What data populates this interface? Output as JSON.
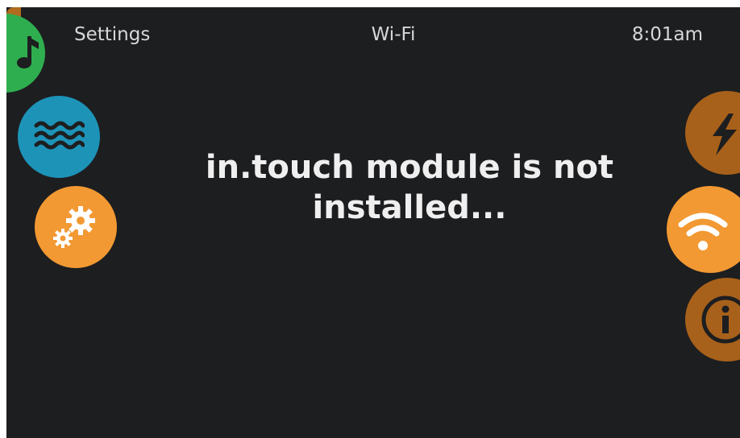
{
  "header": {
    "left_label": "Settings",
    "title": "Wi-Fi",
    "time": "8:01am"
  },
  "message": {
    "line1": "in.touch module is not",
    "line2": "installed..."
  },
  "left_menu": [
    {
      "name": "music",
      "icon": "music-note-icon",
      "color": "#2fae4f"
    },
    {
      "name": "water",
      "icon": "water-waves-icon",
      "color": "#1d93b8"
    },
    {
      "name": "settings",
      "icon": "gears-icon",
      "color": "#f29933"
    }
  ],
  "right_menu": [
    {
      "name": "energy",
      "icon": "lightning-icon",
      "color": "#a8611a"
    },
    {
      "name": "wifi",
      "icon": "wifi-icon",
      "color": "#f29933",
      "active": true
    },
    {
      "name": "info",
      "icon": "info-icon",
      "color": "#a8611a"
    }
  ],
  "colors": {
    "background": "#1d1e20",
    "text": "#d7d7d7",
    "accent_orange": "#f29933",
    "dim_orange": "#a8611a"
  }
}
